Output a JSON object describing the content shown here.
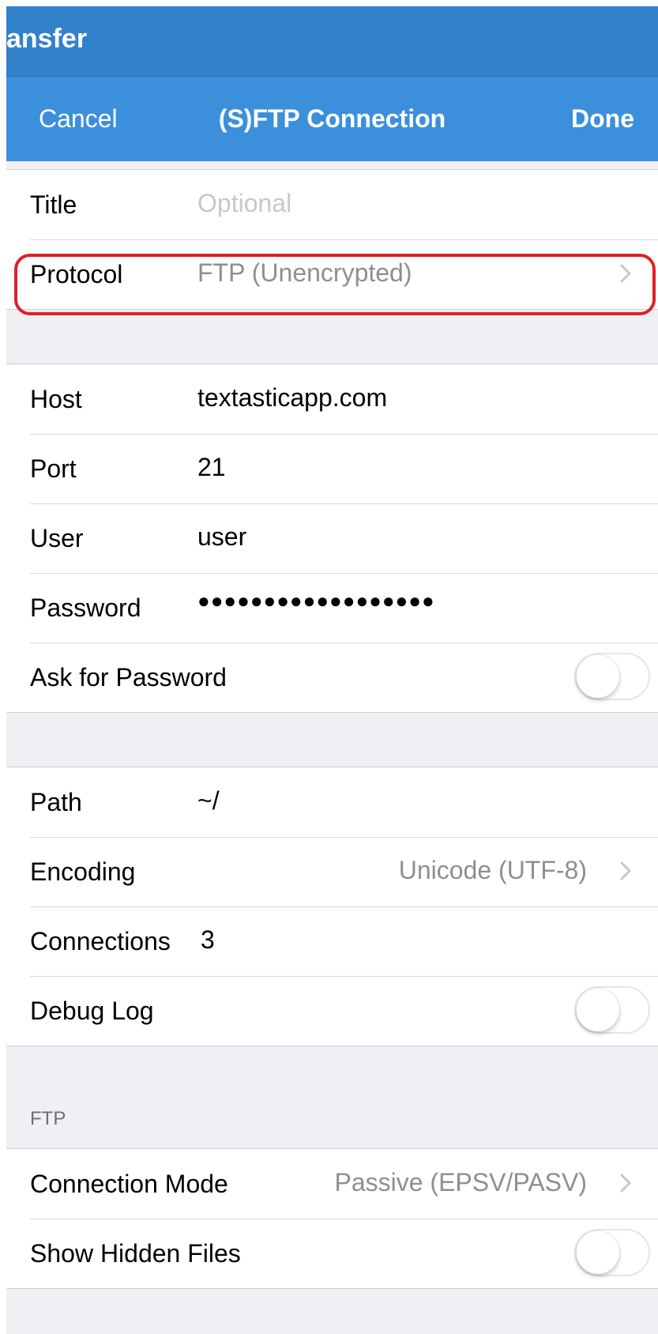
{
  "top_bar": {
    "title_fragment": "ansfer"
  },
  "nav": {
    "cancel": "Cancel",
    "title": "(S)FTP Connection",
    "done": "Done"
  },
  "general": {
    "title_label": "Title",
    "title_placeholder": "Optional",
    "protocol_label": "Protocol",
    "protocol_value": "FTP (Unencrypted)"
  },
  "server": {
    "host_label": "Host",
    "host_value": "textasticapp.com",
    "port_label": "Port",
    "port_value": "21",
    "user_label": "User",
    "user_value": "user",
    "password_label": "Password",
    "password_value": "●●●●●●●●●●●●●●●●●●",
    "ask_password_label": "Ask for Password",
    "ask_password_on": false
  },
  "options": {
    "path_label": "Path",
    "path_value": "~/",
    "encoding_label": "Encoding",
    "encoding_value": "Unicode (UTF-8)",
    "connections_label": "Connections",
    "connections_value": "3",
    "debug_label": "Debug Log",
    "debug_on": false
  },
  "ftp": {
    "header": "FTP",
    "mode_label": "Connection Mode",
    "mode_value": "Passive (EPSV/PASV)",
    "hidden_label": "Show Hidden Files",
    "hidden_on": false
  },
  "colors": {
    "top_bar": "#3281cb",
    "nav_bar": "#3c8fdb",
    "highlight": "#e01f26",
    "background": "#efeff4"
  }
}
